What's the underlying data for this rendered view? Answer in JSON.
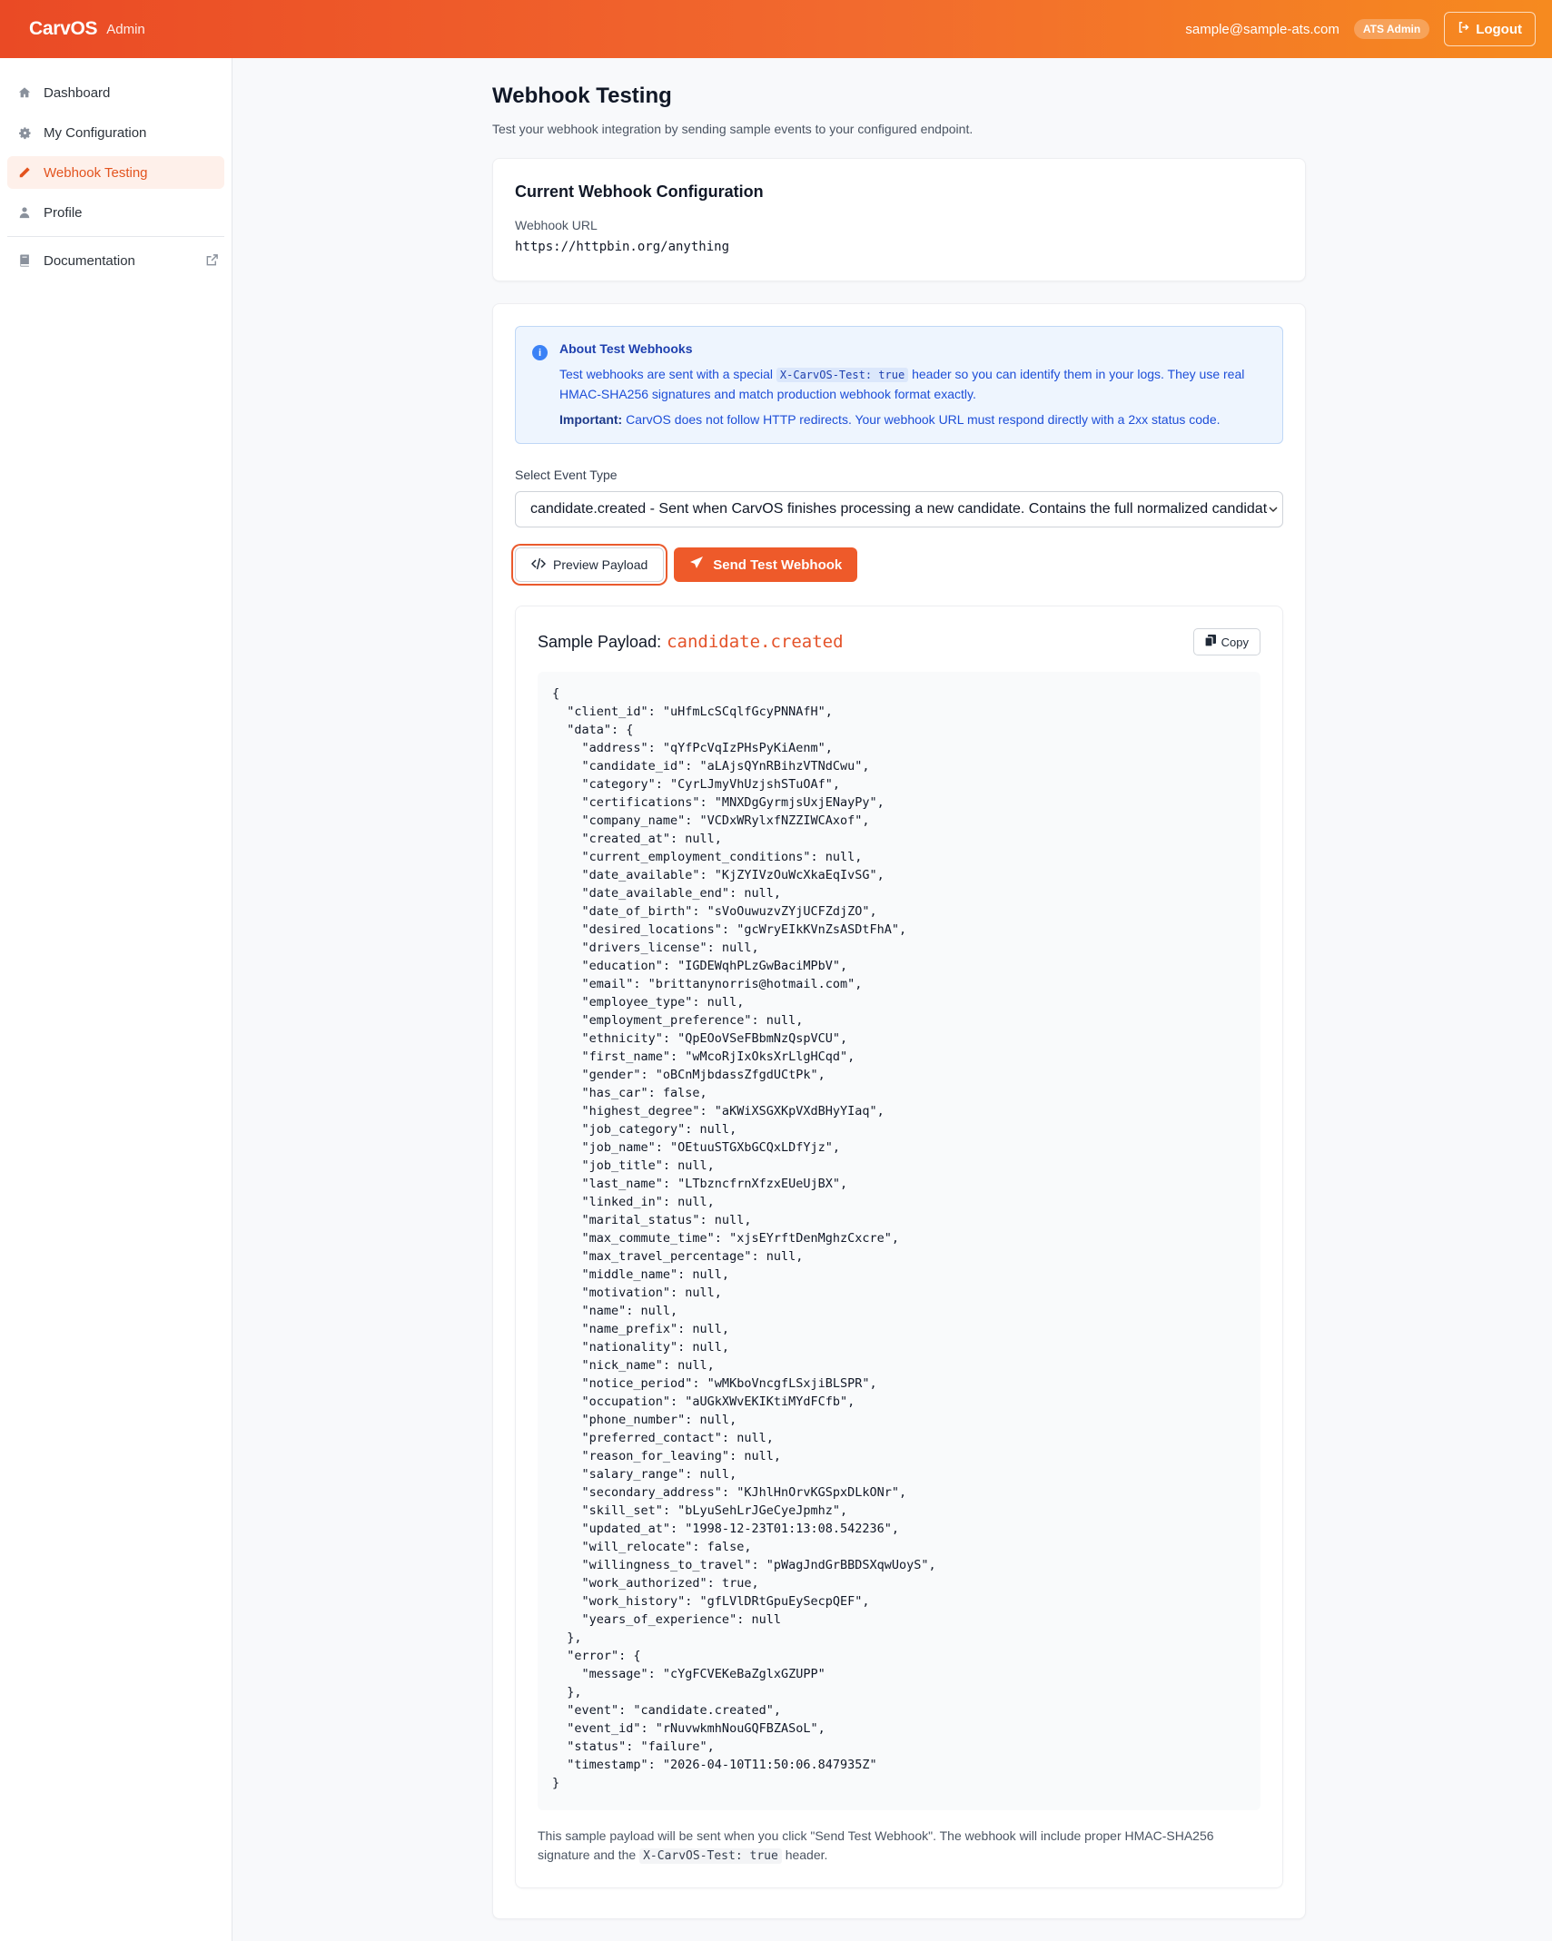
{
  "header": {
    "brand": "CarvOS",
    "brand_sub": "Admin",
    "user_email": "sample@sample-ats.com",
    "role_badge": "ATS Admin",
    "logout_label": "Logout"
  },
  "sidebar": {
    "items": [
      {
        "label": "Dashboard",
        "icon": "home-icon",
        "active": false
      },
      {
        "label": "My Configuration",
        "icon": "gear-icon",
        "active": false
      },
      {
        "label": "Webhook Testing",
        "icon": "pencil-icon",
        "active": true
      },
      {
        "label": "Profile",
        "icon": "user-icon",
        "active": false
      }
    ],
    "documentation": {
      "label": "Documentation",
      "icon": "book-icon",
      "external_icon": "external-link-icon"
    }
  },
  "page": {
    "title": "Webhook Testing",
    "description": "Test your webhook integration by sending sample events to your configured endpoint."
  },
  "config": {
    "title": "Current Webhook Configuration",
    "url_label": "Webhook URL",
    "url": "https://httpbin.org/anything"
  },
  "info": {
    "title": "About Test Webhooks",
    "text_before": "Test webhooks are sent with a special ",
    "header_code": "X-CarvOS-Test: true",
    "text_after": " header so you can identify them in your logs. They use real HMAC-SHA256 signatures and match production webhook format exactly.",
    "important_label": "Important:",
    "important_text": " CarvOS does not follow HTTP redirects. Your webhook URL must respond directly with a 2xx status code."
  },
  "event_select": {
    "label": "Select Event Type",
    "selected": "candidate.created - Sent when CarvOS finishes processing a new candidate. Contains the full normalized candidate"
  },
  "buttons": {
    "preview": "Preview Payload",
    "send": "Send Test Webhook"
  },
  "payload": {
    "title": "Sample Payload:",
    "event": "candidate.created",
    "copy_label": "Copy",
    "lines": [
      "{",
      "  \"client_id\": \"uHfmLcSCqlfGcyPNNAfH\",",
      "  \"data\": {",
      "    \"address\": \"qYfPcVqIzPHsPyKiAenm\",",
      "    \"candidate_id\": \"aLAjsQYnRBihzVTNdCwu\",",
      "    \"category\": \"CyrLJmyVhUzjshSTuOAf\",",
      "    \"certifications\": \"MNXDgGyrmjsUxjENayPy\",",
      "    \"company_name\": \"VCDxWRylxfNZZIWCAxof\",",
      "    \"created_at\": null,",
      "    \"current_employment_conditions\": null,",
      "    \"date_available\": \"KjZYIVzOuWcXkaEqIvSG\",",
      "    \"date_available_end\": null,",
      "    \"date_of_birth\": \"sVoOuwuzvZYjUCFZdjZO\",",
      "    \"desired_locations\": \"gcWryEIkKVnZsASDtFhA\",",
      "    \"drivers_license\": null,",
      "    \"education\": \"IGDEWqhPLzGwBaciMPbV\",",
      "    \"email\": \"brittanynorris@hotmail.com\",",
      "    \"employee_type\": null,",
      "    \"employment_preference\": null,",
      "    \"ethnicity\": \"QpEOoVSeFBbmNzQspVCU\",",
      "    \"first_name\": \"wMcoRjIxOksXrLlgHCqd\",",
      "    \"gender\": \"oBCnMjbdassZfgdUCtPk\",",
      "    \"has_car\": false,",
      "    \"highest_degree\": \"aKWiXSGXKpVXdBHyYIaq\",",
      "    \"job_category\": null,",
      "    \"job_name\": \"OEtuuSTGXbGCQxLDfYjz\",",
      "    \"job_title\": null,",
      "    \"last_name\": \"LTbzncfrnXfzxEUeUjBX\",",
      "    \"linked_in\": null,",
      "    \"marital_status\": null,",
      "    \"max_commute_time\": \"xjsEYrftDenMghzCxcre\",",
      "    \"max_travel_percentage\": null,",
      "    \"middle_name\": null,",
      "    \"motivation\": null,",
      "    \"name\": null,",
      "    \"name_prefix\": null,",
      "    \"nationality\": null,",
      "    \"nick_name\": null,",
      "    \"notice_period\": \"wMKboVncgfLSxjiBLSPR\",",
      "    \"occupation\": \"aUGkXWvEKIKtiMYdFCfb\",",
      "    \"phone_number\": null,",
      "    \"preferred_contact\": null,",
      "    \"reason_for_leaving\": null,",
      "    \"salary_range\": null,",
      "    \"secondary_address\": \"KJhlHnOrvKGSpxDLkONr\",",
      "    \"skill_set\": \"bLyuSehLrJGeCyeJpmhz\",",
      "    \"updated_at\": \"1998-12-23T01:13:08.542236\",",
      "    \"will_relocate\": false,",
      "    \"willingness_to_travel\": \"pWagJndGrBBDSXqwUoyS\",",
      "    \"work_authorized\": true,",
      "    \"work_history\": \"gfLVlDRtGpuEySecpQEF\",",
      "    \"years_of_experience\": null",
      "  },",
      "  \"error\": {",
      "    \"message\": \"cYgFCVEKeBaZglxGZUPP\"",
      "  },",
      "  \"event\": \"candidate.created\",",
      "  \"event_id\": \"rNuvwkmhNouGQFBZASoL\",",
      "  \"status\": \"failure\",",
      "  \"timestamp\": \"2026-04-10T11:50:06.847935Z\"",
      "}"
    ],
    "note_before": "This sample payload will be sent when you click \"Send Test Webhook\". The webhook will include proper HMAC-SHA256 signature and the ",
    "note_code": "X-CarvOS-Test: true",
    "note_after": " header."
  }
}
